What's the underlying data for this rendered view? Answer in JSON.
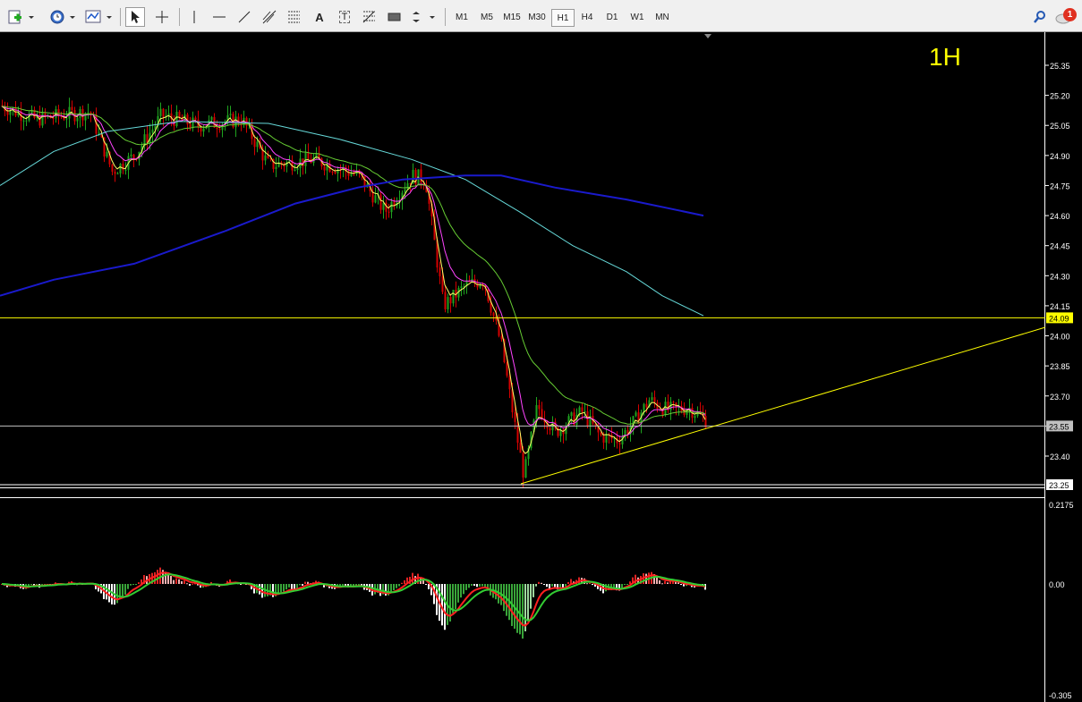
{
  "toolbar": {
    "tools": [
      "new-chart",
      "profiles",
      "indicators",
      "cursor",
      "crosshair",
      "vertical-line",
      "horizontal-line",
      "trendline",
      "equidistant-channel",
      "fibonacci-retracement",
      "text",
      "text-label",
      "fibonacci-fan",
      "rectangle",
      "arrows"
    ],
    "text_tool_label": "A",
    "text_label_tool_label": "T",
    "timeframes": [
      "M1",
      "M5",
      "M15",
      "M30",
      "H1",
      "H4",
      "D1",
      "W1",
      "MN"
    ],
    "active_timeframe": "H1",
    "notification_count": "1"
  },
  "chart": {
    "timeframe_label": "1H",
    "price_axis": [
      "25.35",
      "25.20",
      "25.05",
      "24.90",
      "24.75",
      "24.60",
      "24.45",
      "24.30",
      "24.15",
      "24.00",
      "23.85",
      "23.70",
      "23.55",
      "23.40"
    ],
    "marked_levels": [
      {
        "value": "24.09",
        "color": "#ffff00",
        "text_color": "#000000"
      },
      {
        "value": "23.55",
        "color": "#c0c0c0",
        "text_color": "#000000"
      },
      {
        "value": "23.25",
        "color": "#ffffff",
        "text_color": "#000000"
      }
    ],
    "indicator_axis": [
      "0.2175",
      "0.00",
      "-0.305"
    ],
    "colors": {
      "background": "#000000",
      "bull_candle": "#1fa31f",
      "bear_candle": "#d40000",
      "ma_fast": "#ffff66",
      "ma_medium": "#ff44ff",
      "ma_slow": "#66cc33",
      "ma_slower": "#66d9d9",
      "ma_slowest": "#1a1acc",
      "trendline": "#ffff00",
      "macd_line": "#ff2020",
      "signal_line": "#33cc33"
    }
  }
}
